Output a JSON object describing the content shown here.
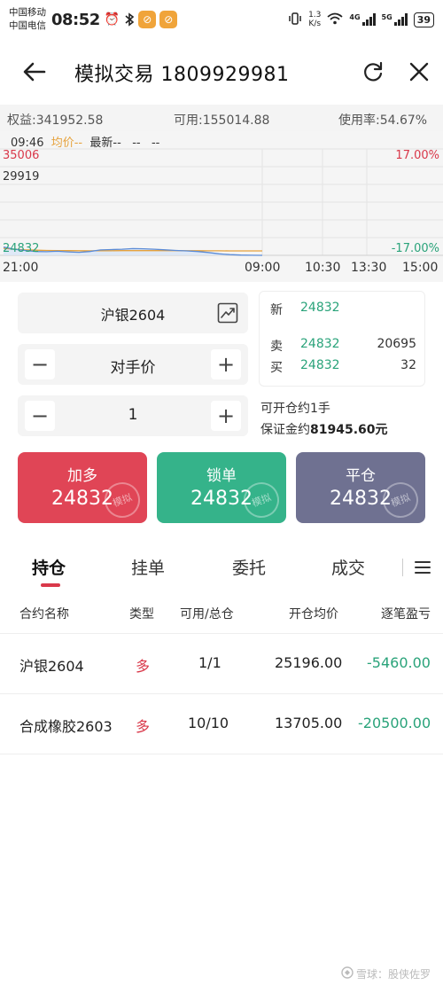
{
  "status_bar": {
    "carrier1": "中国移动",
    "carrier2": "中国电信",
    "time": "08:52",
    "speed_value": "1.3",
    "speed_unit": "K/s",
    "net1": "4G",
    "net2": "5G",
    "battery": "39"
  },
  "header": {
    "title": "模拟交易 1809929981"
  },
  "account": {
    "equity": "权益:341952.58",
    "available": "可用:155014.88",
    "usage": "使用率:54.67%"
  },
  "chart_data": {
    "type": "line",
    "legend_time": "09:46",
    "legend_avg": "均价--",
    "legend_last": "最新--",
    "legend_dash1": "--",
    "legend_dash2": "--",
    "y_top_label": "35006",
    "y_mid_label": "29919",
    "y_bottom_label": "24832",
    "pct_top_label": "17.00%",
    "pct_bottom_label": "-17.00%",
    "x_labels": [
      "21:00",
      "09:00",
      "10:30",
      "13:30",
      "15:00"
    ],
    "ylim": [
      24832,
      35006
    ],
    "series": [
      {
        "values": [
          25620,
          25420,
          25300,
          25200,
          25180,
          25220,
          25160,
          25120,
          25200,
          25350,
          25380,
          25420,
          25480,
          25460,
          25420,
          25360,
          25300,
          25260,
          25200,
          25100,
          24980,
          24900,
          24860,
          24840,
          24832
        ]
      },
      {
        "values": [
          25500,
          25420,
          25360,
          25320,
          25300,
          25290,
          25280,
          25270,
          25268,
          25270,
          25275,
          25280,
          25282,
          25284,
          25283,
          25280,
          25278,
          25274,
          25270,
          25266,
          25262,
          25260,
          25258,
          25256,
          25255
        ]
      }
    ],
    "colors": {
      "price": "#5b8bd6",
      "avg": "#e6a23c",
      "fill": "#dbe6f7",
      "up": "#d9384a",
      "down": "#2aa37a"
    }
  },
  "order": {
    "symbol": "沪银2604",
    "price_type": "对手价",
    "quantity": "1",
    "minus": "−",
    "plus": "+"
  },
  "quote": {
    "last_label": "新",
    "last_price": "24832",
    "ask_label": "卖",
    "ask_price": "24832",
    "ask_vol": "20695",
    "bid_label": "买",
    "bid_price": "24832",
    "bid_vol": "32"
  },
  "info": {
    "openable": "可开仓约1手",
    "margin_label": "保证金约",
    "margin_value": "81945.60元"
  },
  "actions": {
    "buy_label": "加多",
    "buy_price": "24832",
    "lock_label": "锁单",
    "lock_price": "24832",
    "close_label": "平仓",
    "close_price": "24832",
    "stamp": "模拟"
  },
  "tabs": [
    "持仓",
    "挂单",
    "委托",
    "成交"
  ],
  "table": {
    "headers": [
      "合约名称",
      "类型",
      "可用/总仓",
      "开仓均价",
      "逐笔盈亏"
    ],
    "rows": [
      {
        "name": "沪银2604",
        "type": "多",
        "qty": "1/1",
        "avg": "25196.00",
        "pnl": "-5460.00"
      },
      {
        "name": "合成橡胶2603",
        "type": "多",
        "qty": "10/10",
        "avg": "13705.00",
        "pnl": "-20500.00"
      }
    ]
  },
  "watermark": "雪球：股侠佐罗"
}
